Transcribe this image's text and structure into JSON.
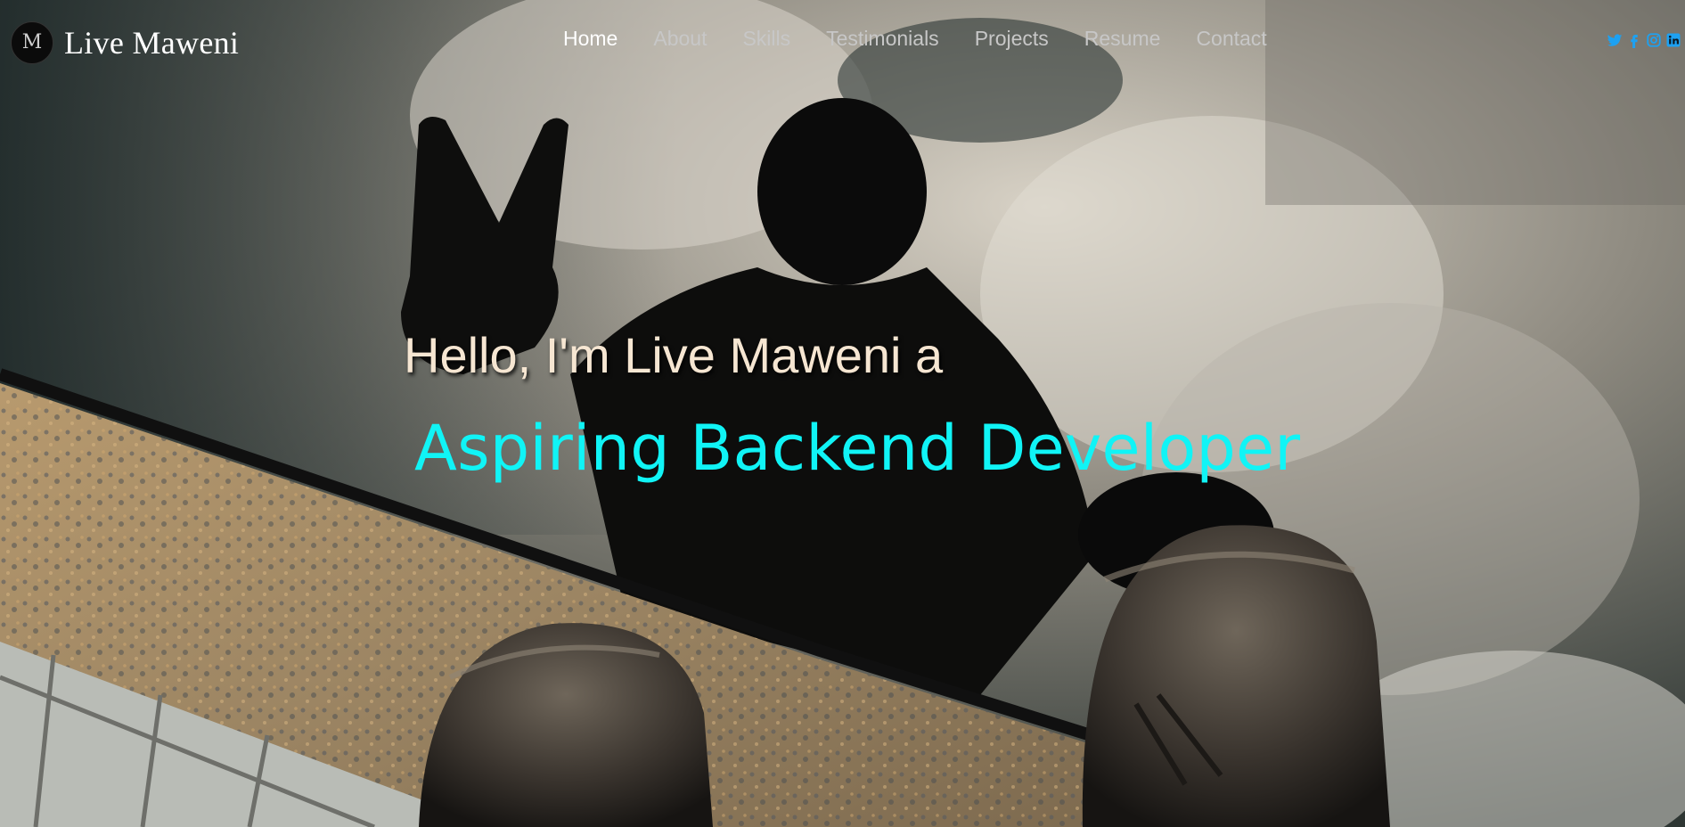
{
  "brand": {
    "logo_letter": "M",
    "name": "Live Maweni"
  },
  "nav": {
    "items": [
      {
        "label": "Home",
        "active": true
      },
      {
        "label": "About",
        "active": false
      },
      {
        "label": "Skills",
        "active": false
      },
      {
        "label": "Testimonials",
        "active": false
      },
      {
        "label": "Projects",
        "active": false
      },
      {
        "label": "Resume",
        "active": false
      },
      {
        "label": "Contact",
        "active": false
      }
    ]
  },
  "social": {
    "icons": [
      "twitter-icon",
      "facebook-icon",
      "instagram-icon",
      "linkedin-icon"
    ],
    "color": "#1da1f2"
  },
  "hero": {
    "greeting": "Hello, I'm Live Maweni a",
    "role": "Aspiring Backend Developer",
    "greeting_color": "#f6e6d2",
    "role_color": "#10f4f6"
  }
}
